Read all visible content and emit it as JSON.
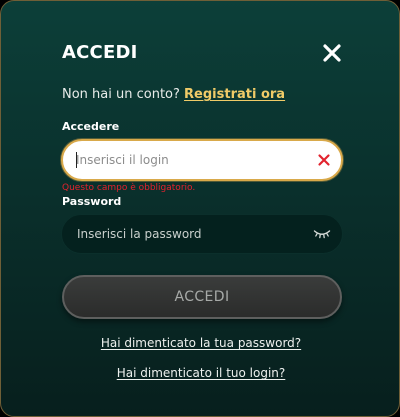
{
  "modal": {
    "title": "ACCEDI",
    "close_icon": "close-icon"
  },
  "signup": {
    "prompt": "Non hai un conto?",
    "link": "Registrati ora"
  },
  "login": {
    "label": "Accedere",
    "placeholder": "Inserisci il login",
    "value": "",
    "clear_icon": "clear-icon",
    "error": "Questo campo è obbligatorio."
  },
  "password": {
    "label": "Password",
    "placeholder": "Inserisci la password",
    "value": "",
    "toggle_icon": "eye-closed-icon"
  },
  "submit": {
    "label": "ACCEDI"
  },
  "links": {
    "forgot_password": "Hai dimenticato la tua password?",
    "forgot_login": "Hai dimenticato il tuo login?"
  },
  "colors": {
    "accent": "#f0cb68",
    "field_border": "#d9a94a",
    "error": "#e2232e",
    "background": "#0c3f39"
  }
}
